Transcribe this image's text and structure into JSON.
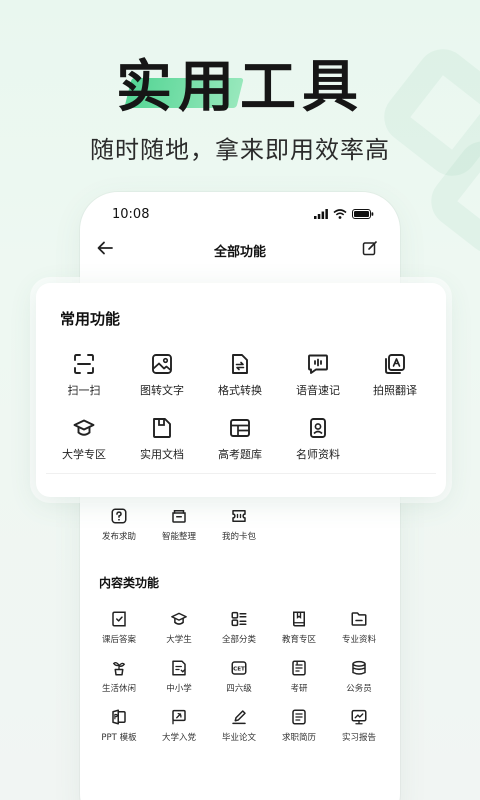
{
  "hero": {
    "title": "实用工具",
    "subtitle": "随时随地，拿来即用效率高"
  },
  "status_bar": {
    "time": "10:08"
  },
  "navbar": {
    "title": "全部功能"
  },
  "common": {
    "title": "常用功能",
    "items": [
      {
        "label": "扫一扫",
        "icon": "scan-icon"
      },
      {
        "label": "图转文字",
        "icon": "image-to-text-icon"
      },
      {
        "label": "格式转换",
        "icon": "format-convert-icon"
      },
      {
        "label": "语音速记",
        "icon": "voice-note-icon"
      },
      {
        "label": "拍照翻译",
        "icon": "photo-translate-icon"
      },
      {
        "label": "大学专区",
        "icon": "graduation-cap-icon"
      },
      {
        "label": "实用文档",
        "icon": "document-icon"
      },
      {
        "label": "高考题库",
        "icon": "question-bank-icon"
      },
      {
        "label": "名师资料",
        "icon": "teacher-badge-icon"
      }
    ]
  },
  "extra": {
    "items": [
      {
        "label": "发布求助",
        "icon": "help-icon"
      },
      {
        "label": "智能整理",
        "icon": "organize-icon"
      },
      {
        "label": "我的卡包",
        "icon": "card-wallet-icon"
      }
    ]
  },
  "content": {
    "title": "内容类功能",
    "items": [
      {
        "label": "课后答案",
        "icon": "answer-book-icon"
      },
      {
        "label": "大学生",
        "icon": "graduation-cap-icon"
      },
      {
        "label": "全部分类",
        "icon": "category-icon"
      },
      {
        "label": "教育专区",
        "icon": "education-book-icon"
      },
      {
        "label": "专业资料",
        "icon": "folder-icon"
      },
      {
        "label": "生活休闲",
        "icon": "plant-icon"
      },
      {
        "label": "中小学",
        "icon": "school-doc-icon"
      },
      {
        "label": "四六级",
        "icon": "cet-icon"
      },
      {
        "label": "考研",
        "icon": "exam-book-icon"
      },
      {
        "label": "公务员",
        "icon": "civil-servant-hat-icon"
      },
      {
        "label": "PPT 模板",
        "icon": "ppt-icon"
      },
      {
        "label": "大学入党",
        "icon": "party-flag-icon"
      },
      {
        "label": "毕业论文",
        "icon": "pen-paper-icon"
      },
      {
        "label": "求职简历",
        "icon": "resume-icon"
      },
      {
        "label": "实习报告",
        "icon": "report-chart-icon"
      }
    ]
  }
}
